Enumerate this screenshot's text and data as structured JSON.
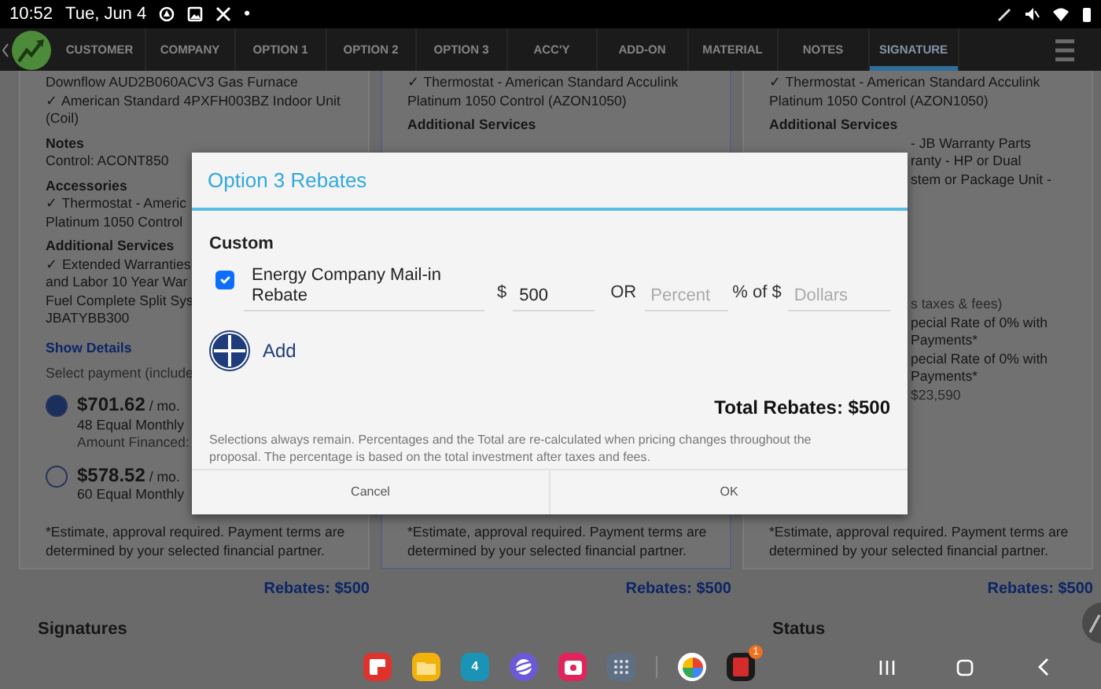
{
  "status_bar": {
    "time": "10:52",
    "date": "Tue, Jun 4",
    "dot": "•"
  },
  "tabs": [
    {
      "label": "CUSTOMER",
      "selected": false
    },
    {
      "label": "COMPANY",
      "selected": false
    },
    {
      "label": "OPTION 1",
      "selected": false
    },
    {
      "label": "OPTION 2",
      "selected": false
    },
    {
      "label": "OPTION 3",
      "selected": false
    },
    {
      "label": "ACC'Y",
      "selected": false
    },
    {
      "label": "ADD-ON",
      "selected": false
    },
    {
      "label": "MATERIAL",
      "selected": false
    },
    {
      "label": "NOTES",
      "selected": false
    },
    {
      "label": "SIGNATURE",
      "selected": true
    }
  ],
  "columns": [
    {
      "selected": false,
      "details": [
        {
          "kind": "item",
          "text": "Downflow AUD2B060ACV3 Gas Furnace"
        },
        {
          "kind": "item",
          "text": "✓ American Standard 4PXFH003BZ Indoor Unit"
        },
        {
          "kind": "item",
          "text": "(Coil)"
        },
        {
          "kind": "heading",
          "text": "Notes"
        },
        {
          "kind": "item",
          "text": "Control: ACONT850"
        },
        {
          "kind": "heading",
          "text": "Accessories"
        },
        {
          "kind": "item",
          "text": "✓ Thermostat - Americ"
        },
        {
          "kind": "item",
          "text": "Platinum 1050 Control"
        },
        {
          "kind": "heading",
          "text": "Additional Services"
        },
        {
          "kind": "item",
          "text": "✓ Extended Warranties"
        },
        {
          "kind": "item",
          "text": "and Labor 10 Year War"
        },
        {
          "kind": "item",
          "text": "Fuel Complete Split Sys"
        },
        {
          "kind": "item",
          "text": "JBATYBB300"
        },
        {
          "kind": "link",
          "text": "Show Details"
        }
      ],
      "bottom": [
        {
          "kind": "hint",
          "text": "Select payment (include"
        },
        {
          "kind": "payment",
          "selected": true,
          "amount": "$701.62",
          "rate": "/ mo.",
          "terms": "48 Equal Monthly",
          "financed": "Amount Financed:"
        },
        {
          "kind": "payment",
          "selected": false,
          "amount": "$578.52",
          "rate": "/ mo.",
          "terms": "60 Equal Monthly"
        }
      ],
      "footnote": "*Estimate, approval required. Payment terms are determined by your selected financial partner.",
      "rebates": "Rebates: $500"
    },
    {
      "selected": true,
      "details": [
        {
          "kind": "item",
          "text": "✓ Thermostat - American Standard Acculink"
        },
        {
          "kind": "item",
          "text": "Platinum 1050 Control (AZON1050)"
        },
        {
          "kind": "heading",
          "text": "Additional Services"
        }
      ],
      "footnote": "*Estimate, approval required. Payment terms are determined by your selected financial partner.",
      "rebates": "Rebates: $500"
    },
    {
      "selected": false,
      "details": [
        {
          "kind": "item",
          "text": "✓ Thermostat - American Standard Acculink"
        },
        {
          "kind": "item",
          "text": "Platinum 1050 Control (AZON1050)"
        },
        {
          "kind": "heading",
          "text": "Additional Services"
        },
        {
          "kind": "tail",
          "text": "- JB Warranty Parts"
        },
        {
          "kind": "tail",
          "text": "ranty - HP or Dual"
        },
        {
          "kind": "tail",
          "text": "stem or Package Unit -"
        }
      ],
      "bottom": [
        {
          "kind": "tail_hint",
          "text": "s taxes & fees)"
        },
        {
          "kind": "tail",
          "text": "pecial Rate of 0% with"
        },
        {
          "kind": "tail",
          "text": "Payments*"
        },
        {
          "kind": "tail",
          "text": "pecial Rate of 0% with"
        },
        {
          "kind": "tail",
          "text": "Payments*"
        },
        {
          "kind": "tail_hint",
          "text": "$23,590"
        }
      ],
      "footnote": "*Estimate, approval required. Payment terms are determined by your selected financial partner.",
      "rebates": "Rebates: $500"
    }
  ],
  "sections": [
    "Signatures",
    "Status"
  ],
  "dialog": {
    "title": "Option 3 Rebates",
    "section": "Custom",
    "rebates": [
      {
        "checked": true,
        "name": "Energy Company Mail-in Rebate",
        "currency": "$",
        "amount": "500",
        "or": "OR",
        "percent_placeholder": "Percent",
        "of_label": "% of $",
        "dollars_placeholder": "Dollars"
      }
    ],
    "add_label": "Add",
    "total": "Total Rebates: $500",
    "note": "Selections always remain. Percentages and the Total are re-calculated when pricing changes throughout the proposal. The percentage is based on the total investment after taxes and fees.",
    "buttons": [
      "Cancel",
      "OK"
    ]
  },
  "taskbar": {
    "calendar_day": "4",
    "badge": "1"
  }
}
